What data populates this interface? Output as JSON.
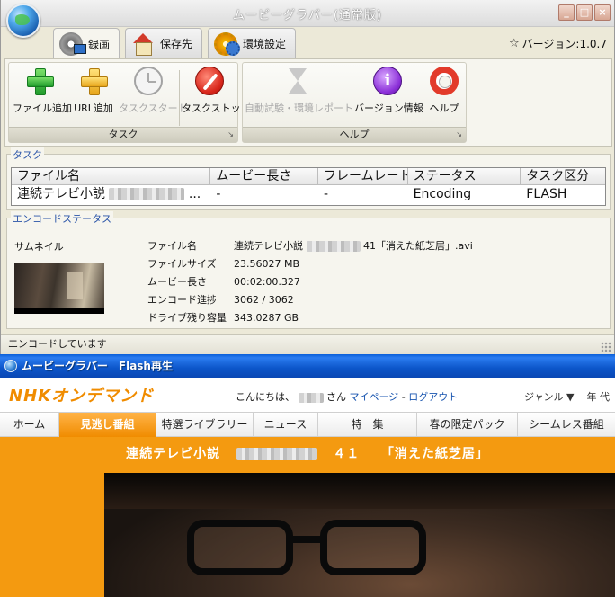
{
  "app": {
    "title": "ムービーグラバー(通常版)",
    "window_buttons": [
      "_",
      "□",
      "×"
    ],
    "tabs": [
      {
        "label": "録画",
        "icon": "film-reel-icon",
        "active": true
      },
      {
        "label": "保存先",
        "icon": "house-icon",
        "active": false
      },
      {
        "label": "環境設定",
        "icon": "gear-icon",
        "active": false
      }
    ],
    "version": "バージョン:1.0.7",
    "ribbon": {
      "task_group": "タスク",
      "help_group": "ヘルプ",
      "buttons": {
        "add_file": "ファイル追加",
        "add_url": "URL追加",
        "task_start": "タスクスタート",
        "task_stop": "タスクストップ",
        "auto_test": "自動試験・環境レポート",
        "version_info": "バージョン情報",
        "help": "ヘルプ"
      }
    },
    "task_section": {
      "label": "タスク",
      "columns": [
        "ファイル名",
        "ムービー長さ",
        "フレームレート",
        "ステータス",
        "タスク区分"
      ],
      "rows": [
        {
          "file": "連続テレビ小説",
          "file_suffix": "...",
          "length": "-",
          "framerate": "-",
          "status": "Encoding",
          "type": "FLASH"
        }
      ]
    },
    "encode_section": {
      "label": "エンコードステータス",
      "thumbnail_label": "サムネイル",
      "fields": [
        {
          "key": "ファイル名",
          "value": "連続テレビ小説",
          "value_suffix": "41「消えた紙芝居」.avi"
        },
        {
          "key": "ファイルサイズ",
          "value": "23.56027 MB"
        },
        {
          "key": "ムービー長さ",
          "value": "00:02:00.327"
        },
        {
          "key": "エンコード進捗",
          "value": "3062 / 3062"
        },
        {
          "key": "ドライブ残り容量",
          "value": "343.0287 GB"
        }
      ]
    },
    "status": "エンコードしています"
  },
  "flash": {
    "title": "ムービーグラバー　Flash再生",
    "logo": "NHKオンデマンド",
    "greeting": "こんにちは、",
    "greeting_suffix": "さん",
    "mypage": "マイページ",
    "separator": "-",
    "logout": "ログアウト",
    "genre": "ジャンル ▼",
    "year": "年 代",
    "nav": [
      "ホーム",
      "見逃し番組",
      "特選ライブラリー",
      "ニュース",
      "特　集",
      "春の限定パック",
      "シームレス番組"
    ],
    "active_nav": 1,
    "episode": {
      "prefix": "連続テレビ小説",
      "number": "４１",
      "title": "「消えた紙芝居」"
    }
  },
  "colors": {
    "accent_orange": "#f49a10",
    "link_blue": "#1a56b0",
    "xp_blue": "#0c55c9"
  }
}
